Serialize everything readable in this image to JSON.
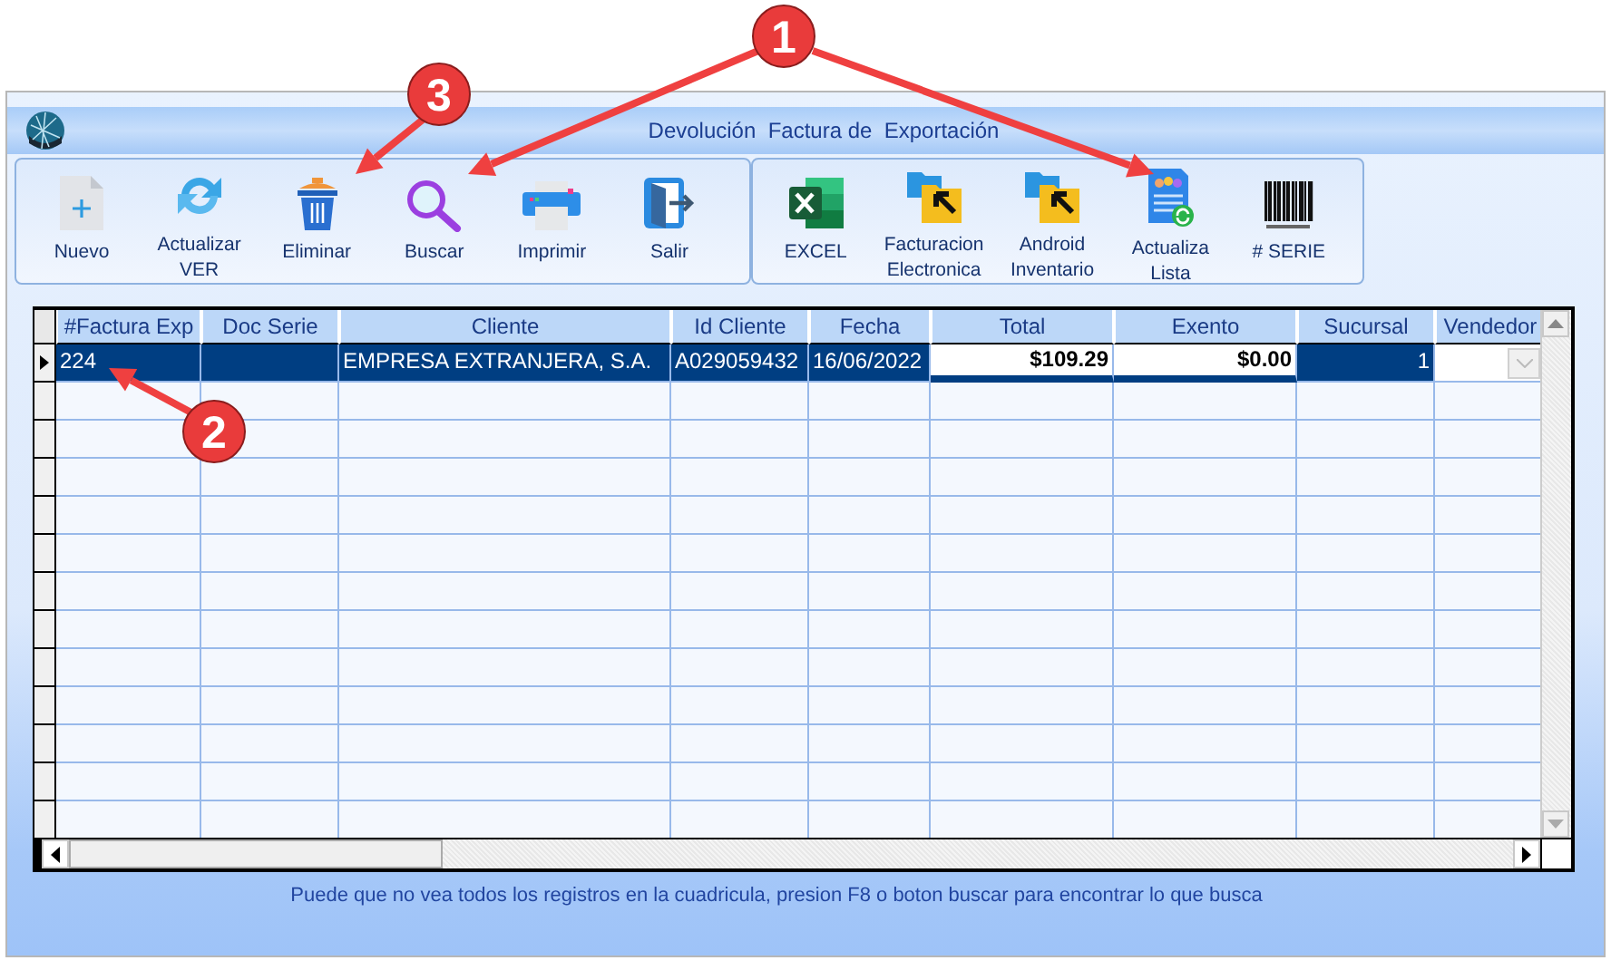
{
  "window": {
    "title": "Devolución  Factura de  Exportación"
  },
  "toolbar_groups": [
    {
      "buttons": [
        {
          "label": "Nuevo"
        },
        {
          "label": "Actualizar\nVER"
        },
        {
          "label": "Eliminar"
        },
        {
          "label": "Buscar"
        },
        {
          "label": "Imprimir"
        },
        {
          "label": "Salir"
        }
      ]
    },
    {
      "buttons": [
        {
          "label": "EXCEL"
        },
        {
          "label": "Facturacion\nElectronica"
        },
        {
          "label": "Android\nInventario"
        },
        {
          "label": "Actualiza\nLista"
        },
        {
          "label": "# SERIE"
        }
      ]
    }
  ],
  "table": {
    "columns": [
      {
        "label": "#Factura Exp",
        "kind": "text"
      },
      {
        "label": "Doc Serie",
        "kind": "text"
      },
      {
        "label": "Cliente",
        "kind": "text"
      },
      {
        "label": "Id Cliente",
        "kind": "text"
      },
      {
        "label": "Fecha",
        "kind": "text"
      },
      {
        "label": "Total",
        "kind": "money"
      },
      {
        "label": "Exento",
        "kind": "money"
      },
      {
        "label": "Sucursal",
        "kind": "number"
      },
      {
        "label": "Vendedor",
        "kind": "combo"
      }
    ],
    "rows": [
      {
        "selected": true,
        "cells": {
          "0": "224",
          "2": "EMPRESA EXTRANJERA, S.A.",
          "3": "A029059432",
          "4": "16/06/2022",
          "5": "$109.29",
          "6": "$0.00",
          "7": "1"
        }
      }
    ]
  },
  "status_bar": "Puede que no vea todos los registros en la cuadricula, presion F8 o boton buscar para encontrar lo que busca",
  "callouts": [
    {
      "label": "1"
    },
    {
      "label": "2"
    },
    {
      "label": "3"
    }
  ]
}
